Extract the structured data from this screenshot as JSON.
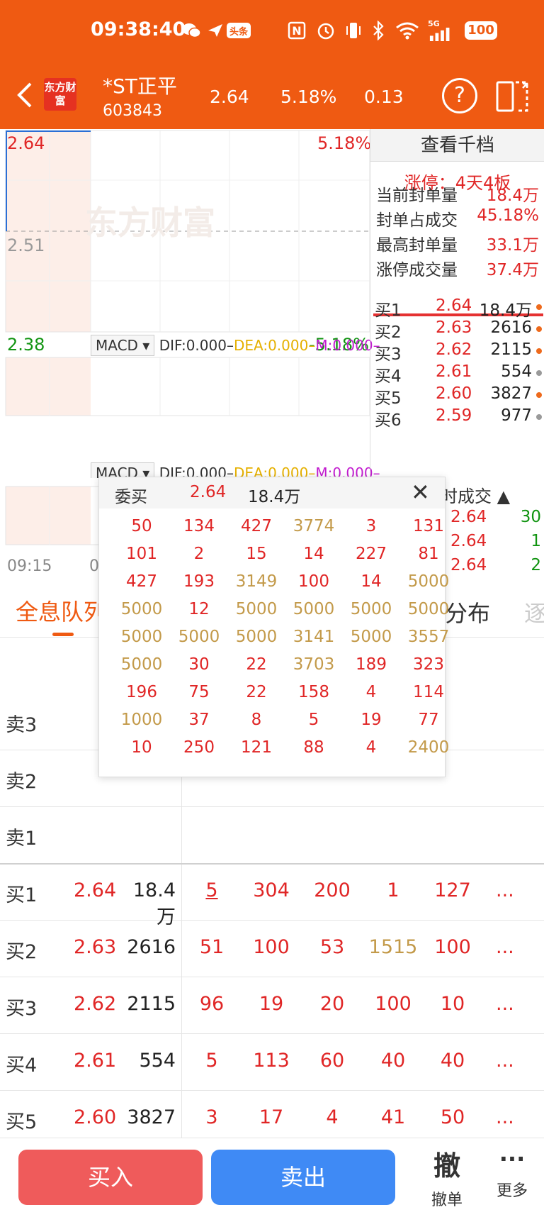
{
  "status_bar": {
    "time": "09:38:40",
    "toutiao_badge": "头条",
    "network": "5G",
    "battery": "100"
  },
  "header": {
    "logo_text": "东方财富",
    "stock_name": "*ST正平",
    "stock_code": "603843",
    "price": "2.64",
    "change_pct": "5.18%",
    "change": "0.13",
    "help_icon": "?"
  },
  "chart": {
    "high_price": "2.64",
    "mid_price": "2.51",
    "low_price": "2.38",
    "high_pct": "5.18%",
    "low_pct": "-5.18%",
    "watermark": "东方财富",
    "time_start": "09:15",
    "time_next_partial": "0",
    "macd": {
      "selector": "MACD ▾",
      "dif": "DIF:0.000–",
      "dea": "DEA:0.000–",
      "m": "M:0.000–"
    }
  },
  "right_panel": {
    "view_depth": "查看千档",
    "limit_title": "涨停：4天4板",
    "stats": [
      {
        "k": "当前封单量",
        "v": "18.4万"
      },
      {
        "k": "封单占成交",
        "v": "45.18%"
      },
      {
        "k": "最高封单量",
        "v": "33.1万"
      },
      {
        "k": "涨停成交量",
        "v": "37.4万"
      }
    ],
    "bids": [
      {
        "lbl": "买1",
        "pr": "2.64",
        "vol": "18.4万",
        "dot": "#ee6a1c"
      },
      {
        "lbl": "买2",
        "pr": "2.63",
        "vol": "2616",
        "dot": "#ee6a1c"
      },
      {
        "lbl": "买3",
        "pr": "2.62",
        "vol": "2115",
        "dot": "#ee6a1c"
      },
      {
        "lbl": "买4",
        "pr": "2.61",
        "vol": "554",
        "dot": "#9a9a9a"
      },
      {
        "lbl": "买5",
        "pr": "2.60",
        "vol": "3827",
        "dot": "#ee6a1c"
      },
      {
        "lbl": "买6",
        "pr": "2.59",
        "vol": "977",
        "dot": "#9a9a9a"
      }
    ],
    "tick_header": "时成交 ▲",
    "ticks": [
      {
        "p": "2.64",
        "q": "30"
      },
      {
        "p": "2.64",
        "q": "1"
      },
      {
        "p": "2.64",
        "q": "2"
      }
    ]
  },
  "tabs": {
    "queue": "全息队列",
    "dist": "分布",
    "more": "逐"
  },
  "queue": {
    "sell_rows": [
      {
        "lbl": "卖3"
      },
      {
        "lbl": "卖2"
      },
      {
        "lbl": "卖1"
      }
    ],
    "buy_rows": [
      {
        "lbl": "买1",
        "pr": "2.64",
        "vol": "18.4万",
        "orders": [
          "5",
          "304",
          "200",
          "1",
          "127"
        ],
        "more": "..."
      },
      {
        "lbl": "买2",
        "pr": "2.63",
        "vol": "2616",
        "orders": [
          "51",
          "100",
          "53",
          "1515",
          "100"
        ],
        "more": "..."
      },
      {
        "lbl": "买3",
        "pr": "2.62",
        "vol": "2115",
        "orders": [
          "96",
          "19",
          "20",
          "100",
          "10"
        ],
        "more": "..."
      },
      {
        "lbl": "买4",
        "pr": "2.61",
        "vol": "554",
        "orders": [
          "5",
          "113",
          "60",
          "40",
          "40"
        ],
        "more": "..."
      },
      {
        "lbl": "买5",
        "pr": "2.60",
        "vol": "3827",
        "orders": [
          "3",
          "17",
          "4",
          "41",
          "50"
        ],
        "more": "..."
      }
    ]
  },
  "popup": {
    "title": "委买",
    "price": "2.64",
    "volume": "18.4万",
    "grid": [
      [
        "50",
        "134",
        "427",
        "3774",
        "3",
        "131"
      ],
      [
        "101",
        "2",
        "15",
        "14",
        "227",
        "81"
      ],
      [
        "427",
        "193",
        "3149",
        "100",
        "14",
        "5000"
      ],
      [
        "5000",
        "12",
        "5000",
        "5000",
        "5000",
        "5000"
      ],
      [
        "5000",
        "5000",
        "5000",
        "3141",
        "5000",
        "3557"
      ],
      [
        "5000",
        "30",
        "22",
        "3703",
        "189",
        "323"
      ],
      [
        "196",
        "75",
        "22",
        "158",
        "4",
        "114"
      ],
      [
        "1000",
        "37",
        "8",
        "5",
        "19",
        "77"
      ],
      [
        "10",
        "250",
        "121",
        "88",
        "4",
        "2400"
      ]
    ]
  },
  "bottom_bar": {
    "buy": "买入",
    "sell": "卖出",
    "cancel_icon": "撤",
    "cancel": "撤单",
    "more_icon": "···",
    "more": "更多"
  },
  "colors": {
    "brand": "#ef5a12",
    "up": "#e02626",
    "gold": "#c39a4a",
    "down": "#119411"
  }
}
